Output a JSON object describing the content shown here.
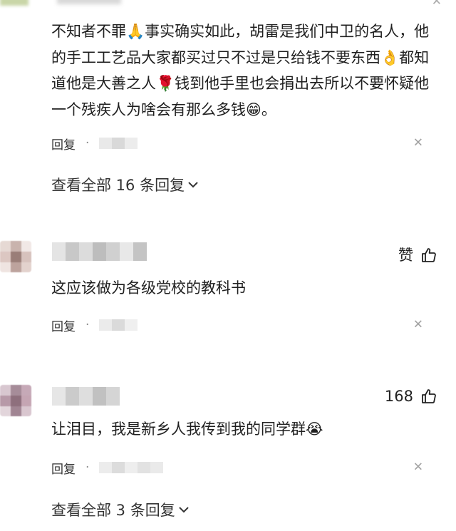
{
  "comments": [
    {
      "id": "c1",
      "text_parts": [
        "不知者不罪",
        "事实确实如此，胡雷是我们中卫的名人，他的手工工艺品大家都买过只不过是只给钱不要东西",
        "都知道他是大善之人",
        "钱到他手里也会捐出去所以不要怀疑他一个残疾人为啥会有那么多钱",
        "。"
      ],
      "emojis": [
        "praying-hands-emoji",
        "ok-hand-emoji",
        "rose-emoji",
        "grinning-emoji"
      ],
      "reply_label": "回复",
      "view_replies_label": "查看全部 16 条回复"
    },
    {
      "id": "c2",
      "like_label": "赞",
      "text": "这应该做为各级党校的教科书",
      "reply_label": "回复"
    },
    {
      "id": "c3",
      "like_count": "168",
      "text": "让泪目，我是新乡人我传到我的同学群",
      "emoji": "crying-emoji",
      "reply_label": "回复",
      "view_replies_label": "查看全部 3 条回复"
    }
  ],
  "icons": {
    "like": "thumbs-up-icon",
    "close": "close-icon",
    "chevron": "chevron-down-icon"
  },
  "colors": {
    "text": "#1f1f1f",
    "secondary": "#333333",
    "muted": "#a3a3a3"
  }
}
